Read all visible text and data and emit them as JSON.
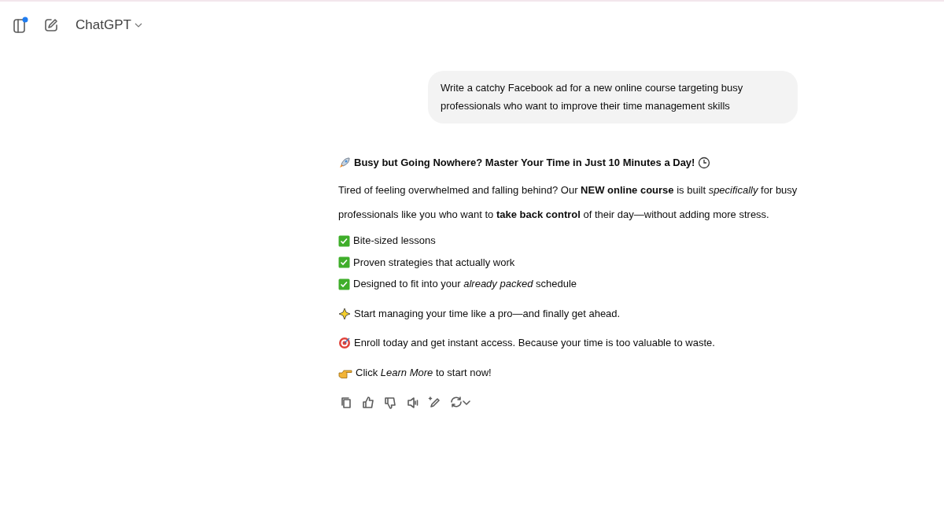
{
  "header": {
    "title": "ChatGPT",
    "sidebar_notification": true
  },
  "user_message": "Write a catchy Facebook ad for a new online course targeting busy professionals who want to improve their time management skills",
  "reply": {
    "headline": "Busy but Going Nowhere? Master Your Time in Just 10 Minutes a Day!",
    "intro": "Tired of feeling overwhelmed and falling behind? Our **NEW online course** is built *specifically* for busy professionals like you who want to **take back control** of their day—without adding more stress.",
    "checklist": [
      "Bite-sized lessons",
      "Proven strategies that actually work",
      "Designed to fit into your *already packed* schedule"
    ],
    "lines": [
      {
        "kind": "sparkle",
        "text": "Start managing your time like a pro—and finally get ahead."
      },
      {
        "kind": "target",
        "text": "Enroll today and get instant access. Because your time is too valuable to waste."
      },
      {
        "kind": "pointer",
        "text": "Click *Learn More* to start now!"
      }
    ]
  }
}
